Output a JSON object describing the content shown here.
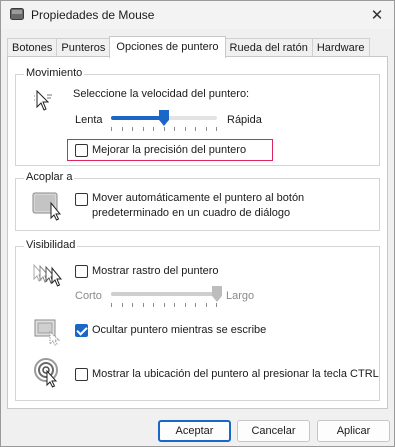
{
  "window": {
    "title": "Propiedades de Mouse",
    "close_glyph": "✕"
  },
  "tabs": [
    {
      "label": "Botones",
      "active": false
    },
    {
      "label": "Punteros",
      "active": false
    },
    {
      "label": "Opciones de puntero",
      "active": true
    },
    {
      "label": "Rueda del ratón",
      "active": false
    },
    {
      "label": "Hardware",
      "active": false
    }
  ],
  "movimiento": {
    "title": "Movimiento",
    "speed_label": "Seleccione la velocidad del puntero:",
    "slow_label": "Lenta",
    "fast_label": "Rápida",
    "speed_value_fraction": 0.5,
    "precision_label": "Mejorar la precisión del puntero",
    "precision_checked": false
  },
  "acoplar": {
    "title": "Acoplar a",
    "snap_label_line1": "Mover automáticamente el puntero al botón",
    "snap_label_line2": "predeterminado en un cuadro de diálogo",
    "snap_checked": false
  },
  "visibilidad": {
    "title": "Visibilidad",
    "trails_label": "Mostrar rastro del puntero",
    "trails_checked": false,
    "short_label": "Corto",
    "long_label": "Largo",
    "trails_value_fraction": 1.0,
    "hide_typing_label": "Ocultar puntero mientras se escribe",
    "hide_typing_checked": true,
    "ctrl_label": "Mostrar la ubicación del puntero al presionar la tecla CTRL",
    "ctrl_checked": false
  },
  "buttons": {
    "accept": "Aceptar",
    "cancel": "Cancelar",
    "apply": "Aplicar"
  },
  "colors": {
    "accent": "#1a67c8",
    "highlight": "#e0245e"
  }
}
